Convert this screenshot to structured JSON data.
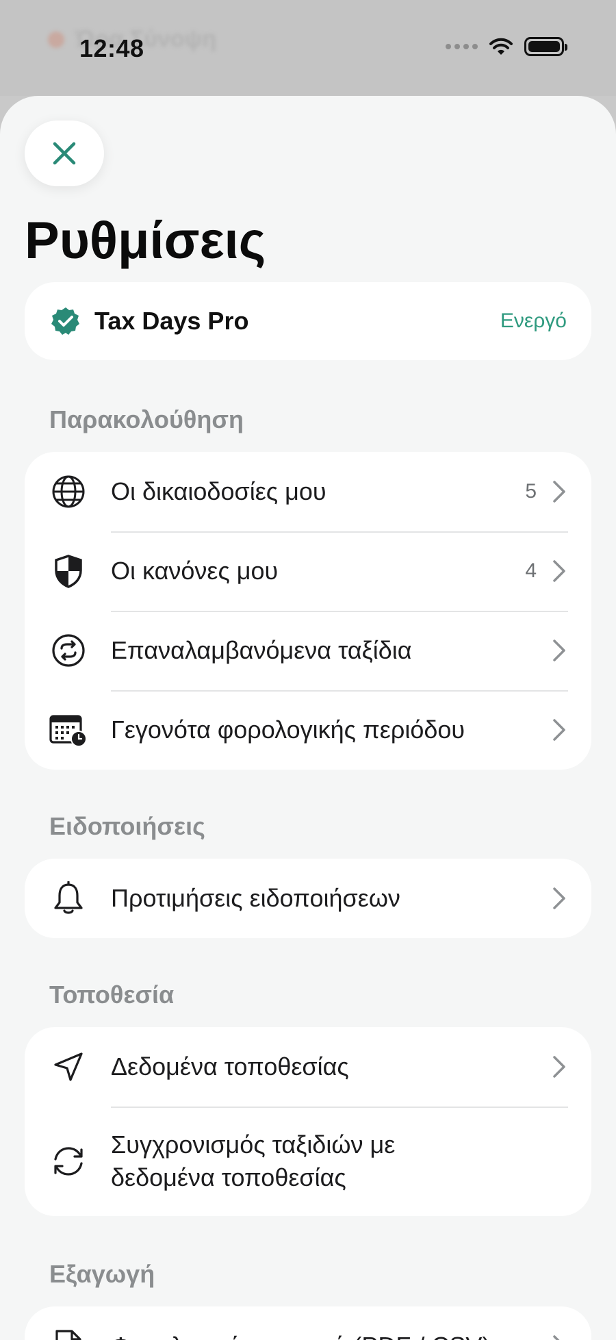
{
  "status_bar": {
    "time": "12:48",
    "background_app_title": "Ώρα Σύνοψη"
  },
  "header": {
    "title": "Ρυθμίσεις",
    "close_icon": "close-icon"
  },
  "subscription": {
    "name": "Tax Days Pro",
    "status": "Ενεργό",
    "accent_color": "#2f9a7f"
  },
  "sections": {
    "tracking": {
      "label": "Παρακολούθηση",
      "items": [
        {
          "label": "Οι δικαιοδοσίες μου",
          "badge": "5",
          "icon": "globe-icon"
        },
        {
          "label": "Οι κανόνες μου",
          "badge": "4",
          "icon": "shield-icon"
        },
        {
          "label": "Επαναλαμβανόμενα ταξίδια",
          "icon": "repeat-icon"
        },
        {
          "label": "Γεγονότα φορολογικής περιόδου",
          "icon": "calendar-clock-icon"
        }
      ]
    },
    "notifications": {
      "label": "Ειδοποιήσεις",
      "items": [
        {
          "label": "Προτιμήσεις ειδοποιήσεων",
          "icon": "bell-icon"
        }
      ]
    },
    "location": {
      "label": "Τοποθεσία",
      "items": [
        {
          "label": "Δεδομένα τοποθεσίας",
          "icon": "location-arrow-icon"
        },
        {
          "label": "Συγχρονισμός ταξιδιών με δεδομένα τοποθεσίας",
          "icon": "sync-icon"
        }
      ]
    },
    "export": {
      "label": "Εξαγωγή",
      "items": [
        {
          "label": "Φορολογική αναφορά (PDF / CSV)",
          "icon": "document-icon"
        }
      ]
    }
  }
}
